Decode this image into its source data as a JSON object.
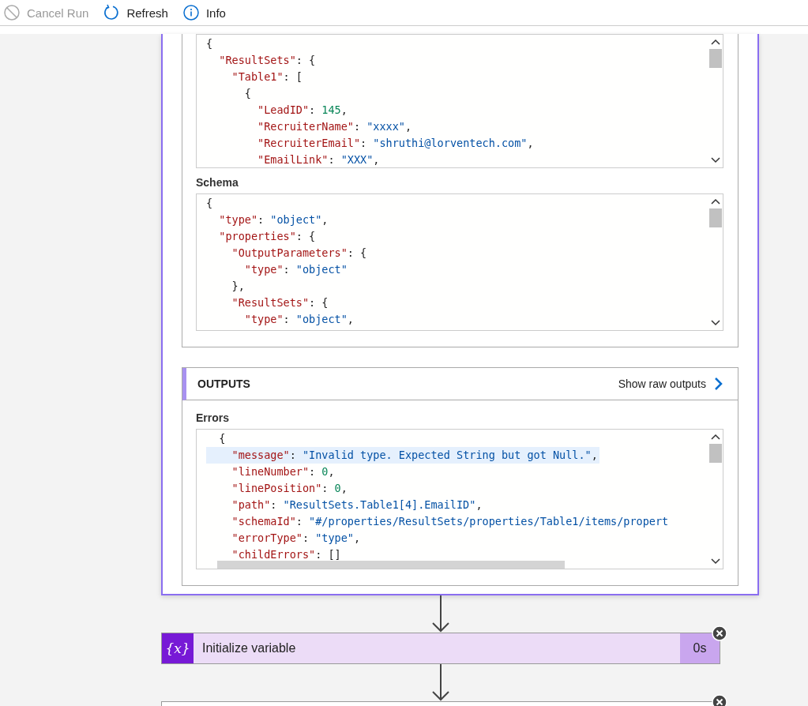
{
  "toolbar": [
    {
      "kind": "cancel",
      "label": "Cancel Run",
      "disabled": true
    },
    {
      "kind": "refresh",
      "label": "Refresh",
      "disabled": false
    },
    {
      "kind": "info",
      "label": "Info",
      "disabled": false
    }
  ],
  "inputs": {
    "body_code": [
      [
        {
          "kind": "punct",
          "text": "{"
        }
      ],
      [
        {
          "kind": "key",
          "text": "  \"ResultSets\""
        },
        {
          "kind": "punct",
          "text": ": {"
        }
      ],
      [
        {
          "kind": "key",
          "text": "    \"Table1\""
        },
        {
          "kind": "punct",
          "text": ": ["
        }
      ],
      [
        {
          "kind": "punct",
          "text": "      {"
        }
      ],
      [
        {
          "kind": "key",
          "text": "        \"LeadID\""
        },
        {
          "kind": "punct",
          "text": ": "
        },
        {
          "kind": "number",
          "text": "145"
        },
        {
          "kind": "punct",
          "text": ","
        }
      ],
      [
        {
          "kind": "key",
          "text": "        \"RecruiterName\""
        },
        {
          "kind": "punct",
          "text": ": "
        },
        {
          "kind": "string",
          "text": "\"xxxx\""
        },
        {
          "kind": "punct",
          "text": ","
        }
      ],
      [
        {
          "kind": "key",
          "text": "        \"RecruiterEmail\""
        },
        {
          "kind": "punct",
          "text": ": "
        },
        {
          "kind": "string",
          "text": "\"shruthi@lorventech.com\""
        },
        {
          "kind": "punct",
          "text": ","
        }
      ],
      [
        {
          "kind": "key",
          "text": "        \"EmailLink\""
        },
        {
          "kind": "punct",
          "text": ": "
        },
        {
          "kind": "string",
          "text": "\"XXX\""
        },
        {
          "kind": "punct",
          "text": ","
        }
      ]
    ],
    "schema_label": "Schema",
    "schema_code": [
      [
        {
          "kind": "punct",
          "text": "{"
        }
      ],
      [
        {
          "kind": "key",
          "text": "  \"type\""
        },
        {
          "kind": "punct",
          "text": ": "
        },
        {
          "kind": "string",
          "text": "\"object\""
        },
        {
          "kind": "punct",
          "text": ","
        }
      ],
      [
        {
          "kind": "key",
          "text": "  \"properties\""
        },
        {
          "kind": "punct",
          "text": ": {"
        }
      ],
      [
        {
          "kind": "key",
          "text": "    \"OutputParameters\""
        },
        {
          "kind": "punct",
          "text": ": {"
        }
      ],
      [
        {
          "kind": "key",
          "text": "      \"type\""
        },
        {
          "kind": "punct",
          "text": ": "
        },
        {
          "kind": "string",
          "text": "\"object\""
        }
      ],
      [
        {
          "kind": "punct",
          "text": "    },"
        }
      ],
      [
        {
          "kind": "key",
          "text": "    \"ResultSets\""
        },
        {
          "kind": "punct",
          "text": ": {"
        }
      ],
      [
        {
          "kind": "key",
          "text": "      \"type\""
        },
        {
          "kind": "punct",
          "text": ": "
        },
        {
          "kind": "string",
          "text": "\"object\""
        },
        {
          "kind": "punct",
          "text": ","
        }
      ]
    ]
  },
  "outputs": {
    "title": "OUTPUTS",
    "raw_link": "Show raw outputs",
    "errors_label": "Errors",
    "errors_code": [
      [
        {
          "kind": "punct",
          "text": "  {"
        }
      ],
      {
        "highlighted": true,
        "tokens": [
          {
            "kind": "key",
            "text": "    \"message\""
          },
          {
            "kind": "punct",
            "text": ": "
          },
          {
            "kind": "string",
            "text": "\"Invalid type. Expected String but got Null.\""
          },
          {
            "kind": "punct",
            "text": ","
          }
        ]
      },
      [
        {
          "kind": "key",
          "text": "    \"lineNumber\""
        },
        {
          "kind": "punct",
          "text": ": "
        },
        {
          "kind": "number",
          "text": "0"
        },
        {
          "kind": "punct",
          "text": ","
        }
      ],
      [
        {
          "kind": "key",
          "text": "    \"linePosition\""
        },
        {
          "kind": "punct",
          "text": ": "
        },
        {
          "kind": "number",
          "text": "0"
        },
        {
          "kind": "punct",
          "text": ","
        }
      ],
      [
        {
          "kind": "key",
          "text": "    \"path\""
        },
        {
          "kind": "punct",
          "text": ": "
        },
        {
          "kind": "string",
          "text": "\"ResultSets.Table1[4].EmailID\""
        },
        {
          "kind": "punct",
          "text": ","
        }
      ],
      [
        {
          "kind": "key",
          "text": "    \"schemaId\""
        },
        {
          "kind": "punct",
          "text": ": "
        },
        {
          "kind": "string",
          "text": "\"#/properties/ResultSets/properties/Table1/items/propert"
        }
      ],
      [
        {
          "kind": "key",
          "text": "    \"errorType\""
        },
        {
          "kind": "punct",
          "text": ": "
        },
        {
          "kind": "string",
          "text": "\"type\""
        },
        {
          "kind": "punct",
          "text": ","
        }
      ],
      [
        {
          "kind": "key",
          "text": "    \"childErrors\""
        },
        {
          "kind": "punct",
          "text": ": []"
        }
      ]
    ]
  },
  "next_step": {
    "icon": "{x}",
    "title": "Initialize variable",
    "duration": "0s"
  }
}
